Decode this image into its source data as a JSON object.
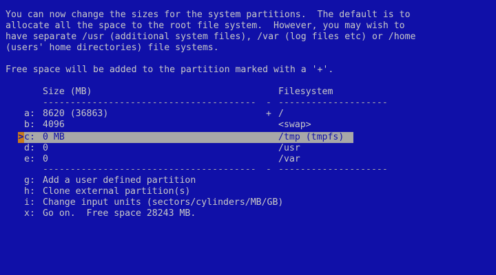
{
  "intro": {
    "line1": "You can now change the sizes for the system partitions.  The default is to",
    "line2": "allocate all the space to the root file system.  However, you may wish to",
    "line3": "have separate /usr (additional system files), /var (log files etc) or /home",
    "line4": "(users' home directories) file systems.",
    "free_space_note": "Free space will be added to the partition marked with a '+'."
  },
  "table": {
    "size_header": "Size (MB)",
    "filesystem_header": "Filesystem",
    "separator_left": "---------------------------------------",
    "separator_mid": "-",
    "separator_right": "--------------------",
    "rows": [
      {
        "key": "a:",
        "size": "8620 (36863)",
        "marker": "+",
        "filesystem": "/"
      },
      {
        "key": "b:",
        "size": "4096",
        "marker": "",
        "filesystem": "<swap>"
      },
      {
        "key": "c:",
        "size": "0 MB",
        "marker": "",
        "filesystem": "/tmp (tmpfs)"
      },
      {
        "key": "d:",
        "size": "0",
        "marker": "",
        "filesystem": "/usr"
      },
      {
        "key": "e:",
        "size": "0",
        "marker": "",
        "filesystem": "/var"
      }
    ],
    "selected_index": 2,
    "cursor_glyph": ">"
  },
  "options": [
    {
      "key": "g:",
      "label": "Add a user defined partition"
    },
    {
      "key": "h:",
      "label": "Clone external partition(s)"
    },
    {
      "key": "i:",
      "label": "Change input units (sectors/cylinders/MB/GB)"
    },
    {
      "key": "x:",
      "label": "Go on.  Free space 28243 MB."
    }
  ],
  "colors": {
    "background": "#1010a8",
    "text": "#c8c8c8",
    "highlight_bar": "#a8a8a8",
    "cursor": "#c87a1e"
  }
}
